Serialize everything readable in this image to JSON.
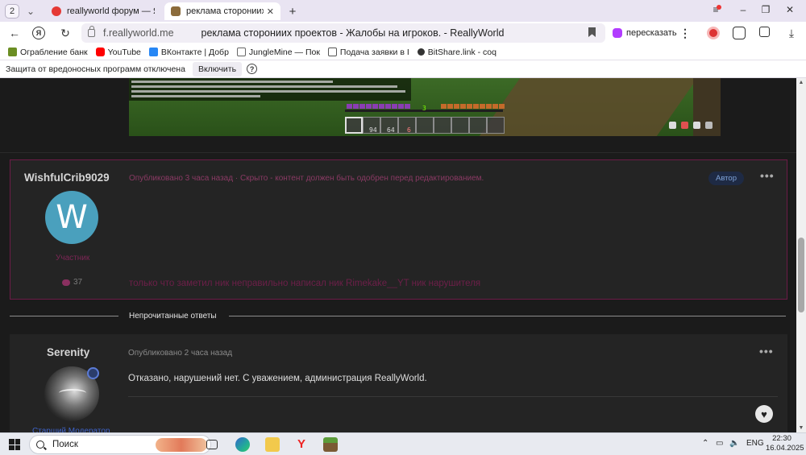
{
  "browser": {
    "tab_count": "2",
    "tabs": [
      {
        "title": "reallyworld форум — Янде",
        "favicon_color": "#e53935"
      },
      {
        "title": "реклама сторониих прое",
        "favicon_color": "#8b6b3b"
      }
    ],
    "address": {
      "domain": "f.reallyworld.me",
      "page_title": "реклама сторониих проектов - Жалобы на игроков. - ReallyWorld"
    },
    "retell_label": "пересказать",
    "bookmarks": [
      {
        "label": "Ограбление банк",
        "icon_color": "#6b8e23"
      },
      {
        "label": "YouTube",
        "icon_color": "#ff0000"
      },
      {
        "label": "ВКонтакте | Добр",
        "icon_color": "#2787f5"
      },
      {
        "label": "JungleMine — Пок",
        "icon_color": "#666666"
      },
      {
        "label": "Подача заявки в I",
        "icon_color": "#555555"
      },
      {
        "label": "BitShare.link - coq",
        "icon_color": "#333333"
      }
    ],
    "protection": {
      "text": "Защита от вредоносных программ отключена",
      "button": "Включить",
      "help": "?"
    }
  },
  "minecraft": {
    "xp_level": "3",
    "slot_counts": [
      "94",
      "64",
      "6"
    ]
  },
  "posts": [
    {
      "username": "WishfulCrib9029",
      "meta": "Опубликовано 3 часа назад · Скрыто - контент должен быть одобрен перед редактированием.",
      "badge": "Автор",
      "avatar_letter": "W",
      "role": "Участник",
      "post_count": "37",
      "body": "только что заметил ник неправильно написал ник Rimekake__YT ник нарушителя"
    },
    {
      "username": "Serenity",
      "meta": "Опубликовано 2 часа назад",
      "body": "Отказано, нарушений нет. С уважением, администрация ReallyWorld.",
      "role": "Старший Модератор"
    }
  ],
  "unread_label": "Непрочитанные ответы",
  "taskbar": {
    "search_placeholder": "Поиск",
    "language": "ENG",
    "time": "22:30",
    "date": "16.04.2025"
  }
}
